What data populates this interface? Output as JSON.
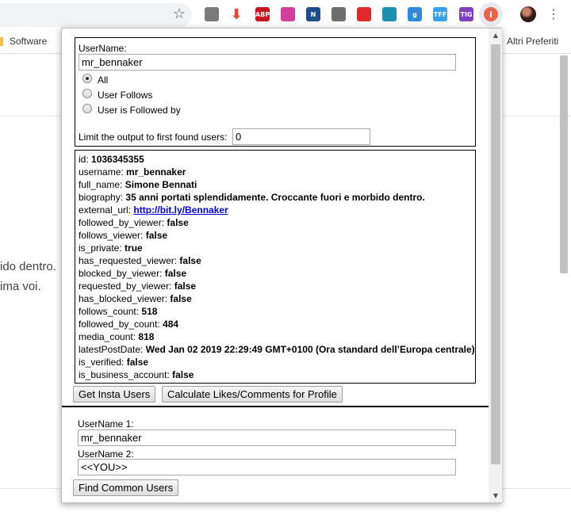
{
  "browser": {
    "star_glyph": "☆",
    "extensions": [
      {
        "name": "screen-capture-icon",
        "color": "#7a7a7a",
        "text": ""
      },
      {
        "name": "download-arrow-icon",
        "color": "#e8453c",
        "text": ""
      },
      {
        "name": "adblock-plus-icon",
        "color": "#c7161e",
        "text": "ABP"
      },
      {
        "name": "pink-heart-icon",
        "color": "#d13f9a",
        "text": ""
      },
      {
        "name": "notion-n-icon",
        "color": "#1d4e89",
        "text": "N"
      },
      {
        "name": "wrench-icon",
        "color": "#6d6d6d",
        "text": ""
      },
      {
        "name": "youtube-icon",
        "color": "#e02a2a",
        "text": ""
      },
      {
        "name": "globe-icon",
        "color": "#1e8fb0",
        "text": ""
      },
      {
        "name": "g-icon",
        "color": "#2f89d6",
        "text": "g"
      },
      {
        "name": "tff-icon",
        "color": "#3aa0e8",
        "text": "TFF"
      },
      {
        "name": "tig-icon",
        "color": "#7e3fbf",
        "text": "TIG"
      },
      {
        "name": "insta-tool-extension-icon",
        "color": "#e8634a",
        "text": "i"
      }
    ],
    "menu_glyph": "⋮",
    "bookmarks": {
      "left": "Software",
      "right": "Altri Preferiti"
    }
  },
  "page_behind": {
    "line1": "ido dentro.",
    "line2": "ima voi."
  },
  "search_panel": {
    "username_label": "UserName:",
    "username_value": "mr_bennaker",
    "options": [
      "All",
      "User Follows",
      "User is Followed by"
    ],
    "selected_option": "All",
    "limit_label": "Limit the output to first found users:",
    "limit_value": "0"
  },
  "profile": {
    "fields": [
      {
        "key": "id",
        "value": "1036345355"
      },
      {
        "key": "username",
        "value": "mr_bennaker"
      },
      {
        "key": "full_name",
        "value": "Simone Bennati"
      },
      {
        "key": "biography",
        "value": "35 anni portati splendidamente. Croccante fuori e morbido dentro."
      },
      {
        "key": "external_url",
        "value": "http://bit.ly/Bennaker"
      },
      {
        "key": "followed_by_viewer",
        "value": "false"
      },
      {
        "key": "follows_viewer",
        "value": "false"
      },
      {
        "key": "is_private",
        "value": "true"
      },
      {
        "key": "has_requested_viewer",
        "value": "false"
      },
      {
        "key": "blocked_by_viewer",
        "value": "false"
      },
      {
        "key": "requested_by_viewer",
        "value": "false"
      },
      {
        "key": "has_blocked_viewer",
        "value": "false"
      },
      {
        "key": "follows_count",
        "value": "518"
      },
      {
        "key": "followed_by_count",
        "value": "484"
      },
      {
        "key": "media_count",
        "value": "818"
      },
      {
        "key": "latestPostDate",
        "value": "Wed Jan 02 2019 22:29:49 GMT+0100 (Ora standard dell’Europa centrale)"
      },
      {
        "key": "is_verified",
        "value": "false"
      },
      {
        "key": "is_business_account",
        "value": "false"
      }
    ]
  },
  "actions": {
    "get_users": "Get Insta Users",
    "calc_likes": "Calculate Likes/Comments for Profile"
  },
  "common_panel": {
    "user1_label": "UserName 1:",
    "user1_value": "mr_bennaker",
    "user2_label": "UserName 2:",
    "user2_value": "<<YOU>>",
    "find_button": "Find Common Users"
  },
  "colors": {
    "link": "#0000ee",
    "accent_extension": "#e8634a"
  }
}
